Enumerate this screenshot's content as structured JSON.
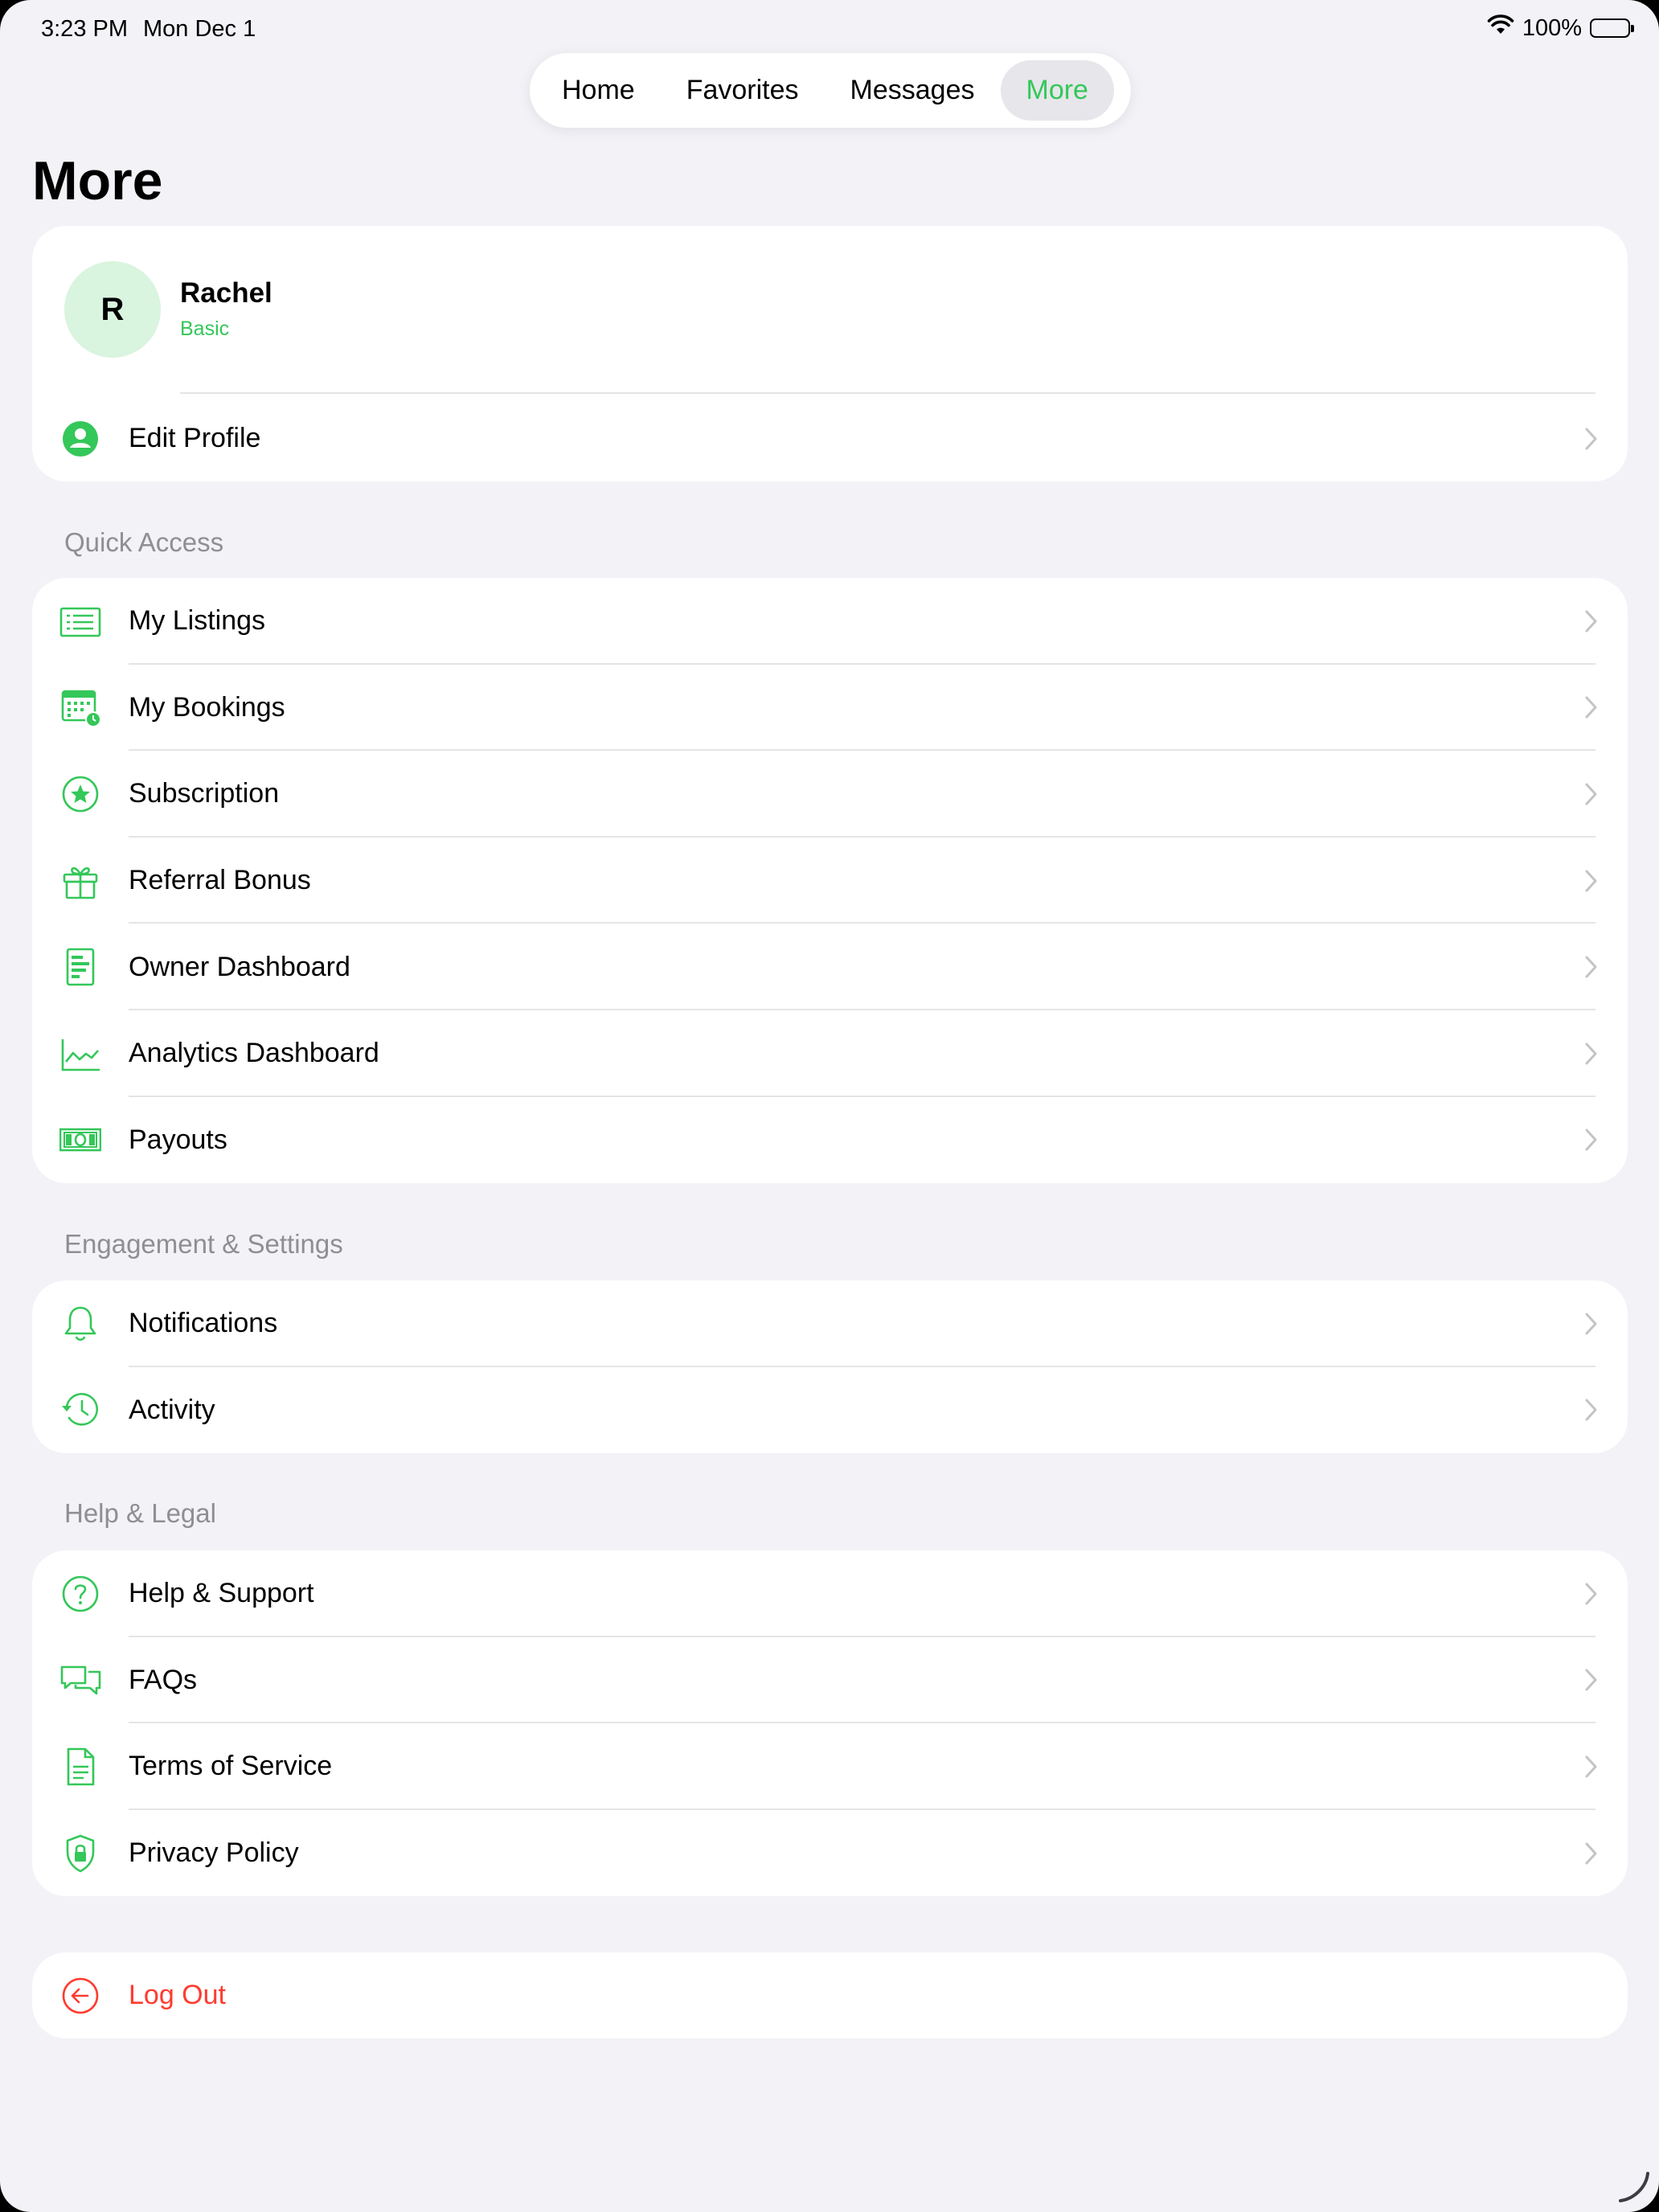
{
  "status_bar": {
    "time": "3:23 PM",
    "date": "Mon Dec 1",
    "battery": "100%"
  },
  "tabs": [
    {
      "label": "Home",
      "active": false
    },
    {
      "label": "Favorites",
      "active": false
    },
    {
      "label": "Messages",
      "active": false
    },
    {
      "label": "More",
      "active": true
    }
  ],
  "page_title": "More",
  "profile": {
    "initial": "R",
    "name": "Rachel",
    "tier": "Basic",
    "edit_label": "Edit Profile"
  },
  "sections": {
    "quick_access": {
      "title": "Quick Access",
      "items": [
        {
          "label": "My Listings",
          "icon": "listings-icon"
        },
        {
          "label": "My Bookings",
          "icon": "calendar-icon"
        },
        {
          "label": "Subscription",
          "icon": "star-icon"
        },
        {
          "label": "Referral Bonus",
          "icon": "gift-icon"
        },
        {
          "label": "Owner Dashboard",
          "icon": "dashboard-icon"
        },
        {
          "label": "Analytics Dashboard",
          "icon": "chart-icon"
        },
        {
          "label": "Payouts",
          "icon": "money-icon"
        }
      ]
    },
    "engagement": {
      "title": "Engagement & Settings",
      "items": [
        {
          "label": "Notifications",
          "icon": "bell-icon"
        },
        {
          "label": "Activity",
          "icon": "history-icon"
        }
      ]
    },
    "help": {
      "title": "Help & Legal",
      "items": [
        {
          "label": "Help & Support",
          "icon": "question-icon"
        },
        {
          "label": "FAQs",
          "icon": "chat-bubbles-icon"
        },
        {
          "label": "Terms of Service",
          "icon": "document-icon"
        },
        {
          "label": "Privacy Policy",
          "icon": "shield-lock-icon"
        }
      ]
    }
  },
  "logout": {
    "label": "Log Out",
    "icon": "logout-icon"
  },
  "colors": {
    "accent": "#34C759",
    "destructive": "#FF3B30",
    "background": "#F2F2F7",
    "secondary_text": "#8E8E93"
  }
}
